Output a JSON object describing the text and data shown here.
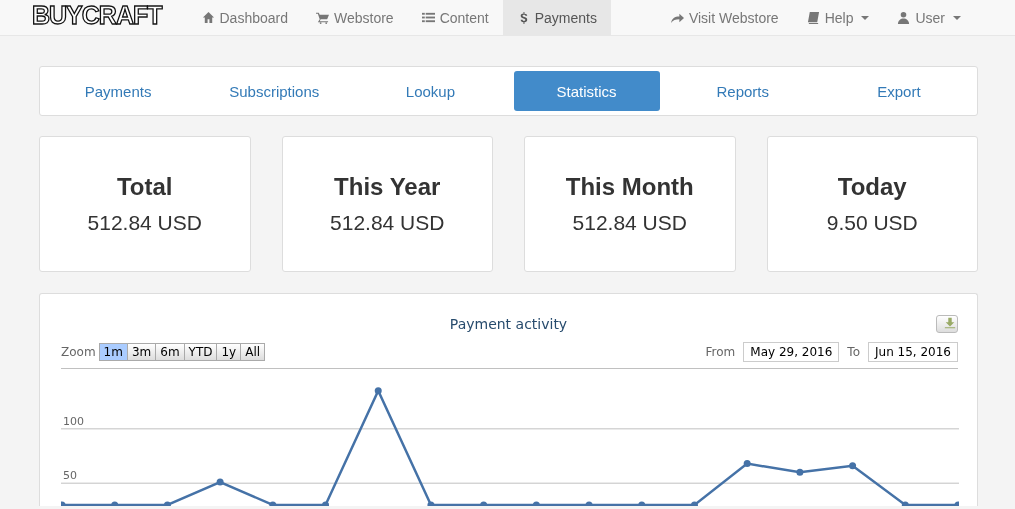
{
  "navbar": {
    "logo": "BUYCRAFT",
    "items": [
      {
        "label": "Dashboard",
        "selected": false
      },
      {
        "label": "Webstore",
        "selected": false
      },
      {
        "label": "Content",
        "selected": false
      },
      {
        "label": "Payments",
        "selected": true
      }
    ],
    "right_items": [
      {
        "label": "Visit Webstore",
        "dropdown": false
      },
      {
        "label": "Help",
        "dropdown": true
      },
      {
        "label": "User",
        "dropdown": true
      }
    ]
  },
  "tabs": [
    {
      "label": "Payments",
      "selected": false
    },
    {
      "label": "Subscriptions",
      "selected": false
    },
    {
      "label": "Lookup",
      "selected": false
    },
    {
      "label": "Statistics",
      "selected": true
    },
    {
      "label": "Reports",
      "selected": false
    },
    {
      "label": "Export",
      "selected": false
    }
  ],
  "stats": [
    {
      "title": "Total",
      "value": "512.84 USD"
    },
    {
      "title": "This Year",
      "value": "512.84 USD"
    },
    {
      "title": "This Month",
      "value": "512.84 USD"
    },
    {
      "title": "Today",
      "value": "9.50 USD"
    }
  ],
  "chart": {
    "zoom_label": "Zoom",
    "zoom_buttons": [
      {
        "label": "1m",
        "selected": true
      },
      {
        "label": "3m",
        "selected": false
      },
      {
        "label": "6m",
        "selected": false
      },
      {
        "label": "YTD",
        "selected": false
      },
      {
        "label": "1y",
        "selected": false
      },
      {
        "label": "All",
        "selected": false
      }
    ],
    "from_label": "From",
    "from": "May 29, 2016",
    "to_label": "To",
    "to": "Jun 15, 2016",
    "chart_data": {
      "type": "line",
      "title": "Payment activity",
      "yticks": [
        50,
        100
      ],
      "ylim": [
        29,
        225
      ],
      "categories": [
        null,
        null,
        null,
        null,
        null,
        null,
        null,
        null,
        null,
        null,
        null,
        null,
        null,
        null,
        null,
        null,
        null,
        null
      ],
      "series": [
        {
          "color": "#4572a7",
          "marker": "circle",
          "values": [
            30,
            30,
            30,
            51,
            30,
            30,
            135,
            30,
            30,
            30,
            30,
            30,
            30,
            68,
            60,
            66,
            30,
            30
          ]
        }
      ]
    }
  }
}
